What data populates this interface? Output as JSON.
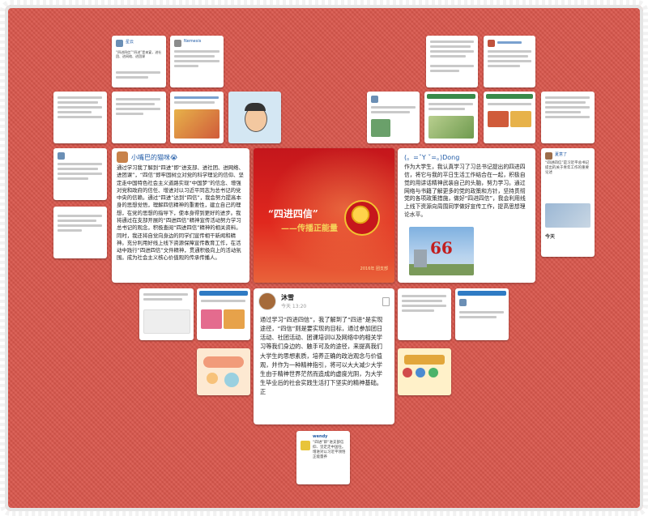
{
  "main_card_left": {
    "username": "小嘴巴的猫咪😭",
    "text": "通过学习我了解到“四进”即“进支部、进社团、进网络、进团课”，“四信”即牢固树立对党的科学理论的信仰、坚定走中国特色社会主义道路实现“中国梦”的信念、增强对党和政府的信任、增进对以习近平同志为总书记的党中央的信赖。通过“四进”达到“四信”，我会努力提高本身的思想觉悟，理解四信精神的重要性，建立自己的理想，在党的思想的指导下，使本身得到更好的进步。我将通过在支部开展的“四进四信”精神宣传活动努力学习总书记的观念，积极查阅“四进四信”精神的相关资料。同时，我还将自觉向身边的同学们宣传相干新闻和精神。充分利用好线上线下资源保障宣传教育工作，在活动中践行“四进四信”文件精神，贯通积极向上的活动氛围。成为社会主义核心价值观的传承传播人。"
  },
  "poster": {
    "title": "“四进四信”",
    "subtitle": "——传播正能量",
    "footer": "2016年 团支部"
  },
  "main_card_right": {
    "username": "(。=ˇY ˇ=。)Dong",
    "text": "作为大学生，我认真学习了习总书记提出的四进四信，将它与我的平日生活工作结合在一起，积极自觉的用讲话精神武装自己的头脑，努力学习。通过网络与书籍了解更多的党的政策和方针，坚持贯彻党的各项政策措施，做好“四进四信”，我会利用线上线下资源向周围同学做好宣传工作，提高思想理论水平。",
    "photo_number": "66"
  },
  "main_card_bottom": {
    "username": "沐雪",
    "time": "今天 13:20",
    "text": "通过学习“四进四信”，我了解到了“四进”是实现途径，“四信”则是要实现的目标，通过参加团日活动、社团活动、团课培训以及网络中的相关学习等我们身边的、触手可及的途径，来提高我们大学生的思想素质，培养正确的政治观念与价值观，并作为一种精神指引，将可以大大减少大学生由于精神世界茫然而造成的虚度光阴，为大学生毕业后的社会实践生活打下坚实的精神基础。正"
  },
  "bottom_thumb": {
    "username": "wendy",
    "text": "“四进”即“进支部信仰、坚定走中国任。增进对以习近平领悟正能量养"
  },
  "right_thumb": {
    "username": "夏意了",
    "text": "“四进四信”是习近平总书记提出的关于青年工作的重要论述",
    "date": "今天"
  },
  "top_thumbs": {
    "t1_name": "星云",
    "t1_text": "“四进四信”“四进”是来宴，进社团、进网络、进团课",
    "t2_name": "Nemesis"
  },
  "colors": {
    "background": "#d9574c",
    "name_blue": "#1f5aa6",
    "poster_red": "#c4161c",
    "poster_gold": "#f6d35a"
  }
}
